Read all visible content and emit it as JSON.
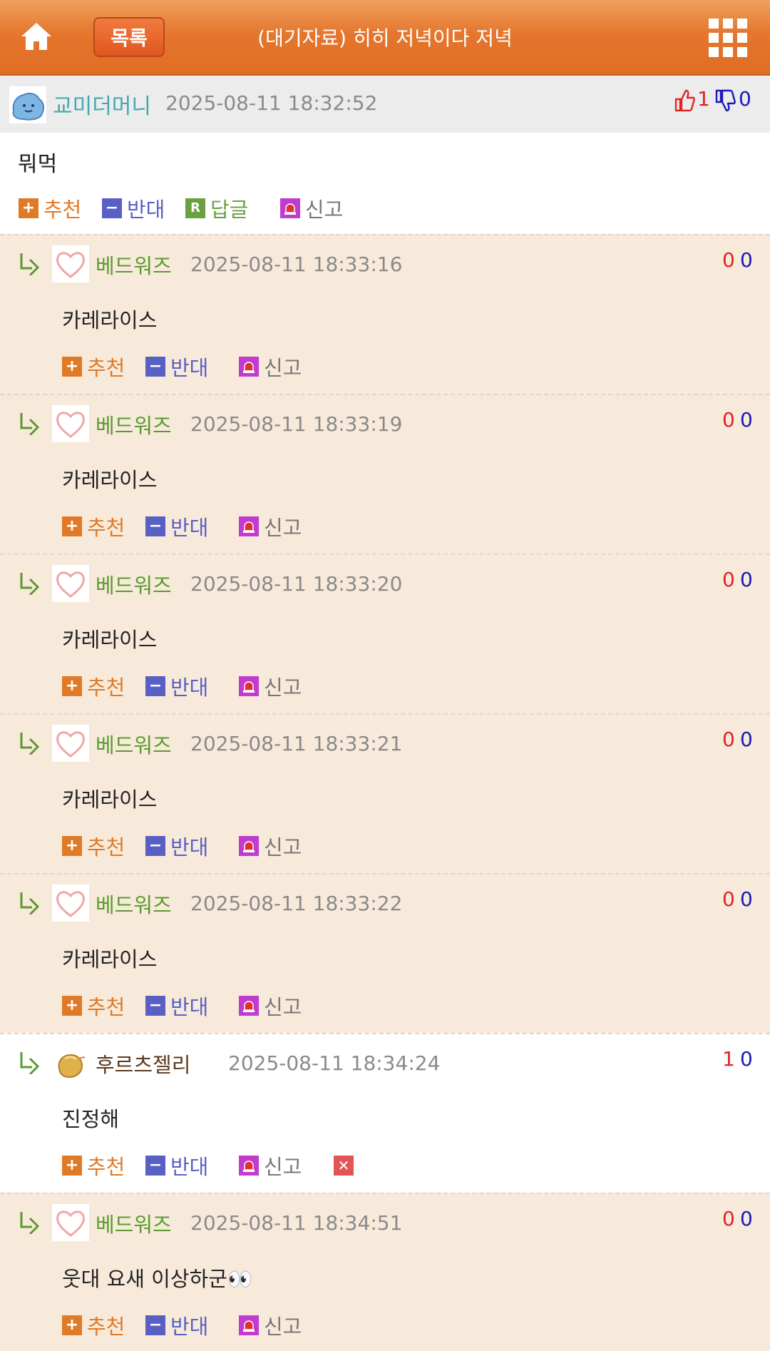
{
  "header": {
    "list_label": "목록",
    "title": "(대기자료) 히히 저녁이다 저녁",
    "home_icon": "home-icon",
    "menu_icon": "grid-menu-icon",
    "bg_color": "#e5762d"
  },
  "post": {
    "author": "교미더머니",
    "date": "2025-08-11 18:32:52",
    "up": "1",
    "down": "0",
    "body": "뭐먹",
    "actions": {
      "recommend": "추천",
      "oppose": "반대",
      "reply": "답글",
      "report": "신고"
    }
  },
  "comment_actions": {
    "recommend": "추천",
    "oppose": "반대",
    "report": "신고"
  },
  "comments": [
    {
      "author": "베드워즈",
      "date": "2025-08-11 18:33:16",
      "up": "0",
      "down": "0",
      "body": "카레라이스"
    },
    {
      "author": "베드워즈",
      "date": "2025-08-11 18:33:19",
      "up": "0",
      "down": "0",
      "body": "카레라이스"
    },
    {
      "author": "베드워즈",
      "date": "2025-08-11 18:33:20",
      "up": "0",
      "down": "0",
      "body": "카레라이스"
    },
    {
      "author": "베드워즈",
      "date": "2025-08-11 18:33:21",
      "up": "0",
      "down": "0",
      "body": "카레라이스"
    },
    {
      "author": "베드워즈",
      "date": "2025-08-11 18:33:22",
      "up": "0",
      "down": "0",
      "body": "카레라이스"
    },
    {
      "author": "후르츠젤리",
      "date": "2025-08-11 18:34:24",
      "up": "1",
      "down": "0",
      "body": "진정해"
    },
    {
      "author": "베드워즈",
      "date": "2025-08-11 18:34:51",
      "up": "0",
      "down": "0",
      "body": "웃대 요새 이상하군👀"
    }
  ]
}
